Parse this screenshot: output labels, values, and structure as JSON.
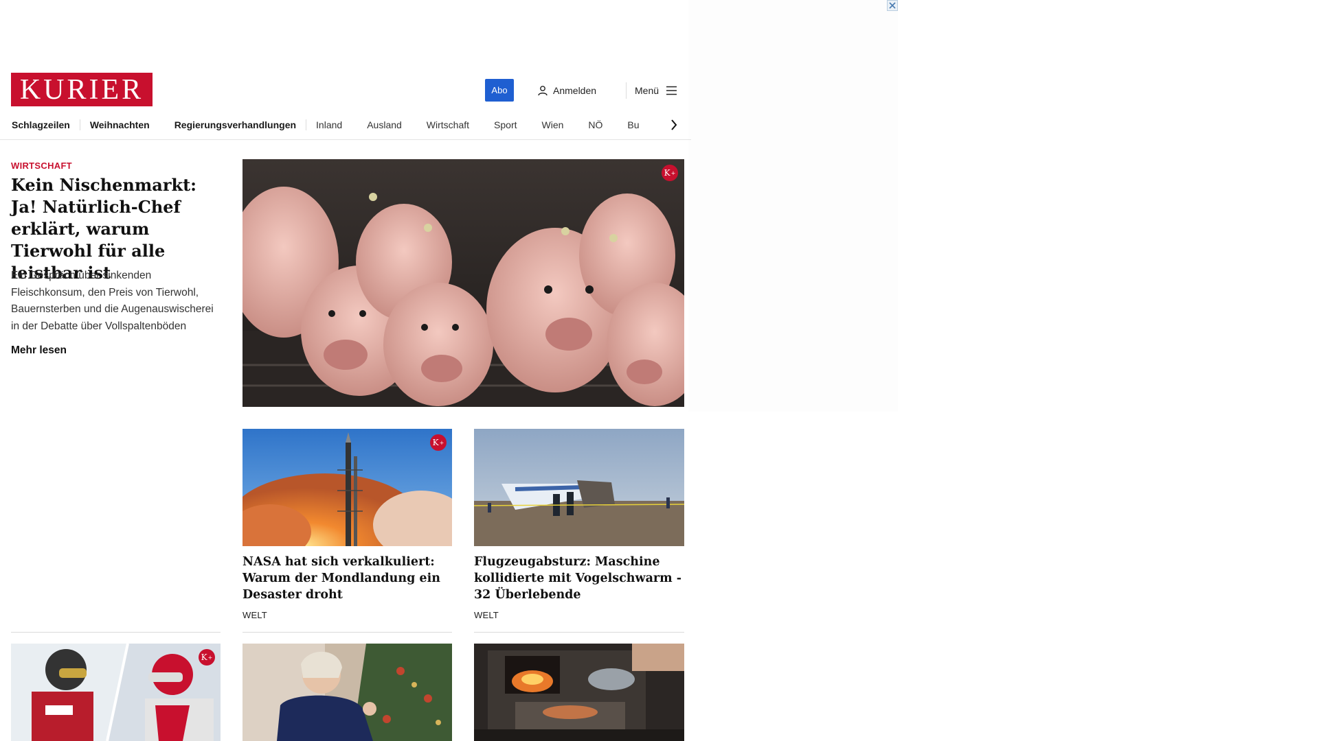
{
  "ad": {
    "close_icon": "close-icon"
  },
  "header": {
    "logo_text": "KURIER",
    "abo_label": "Abo",
    "login_label": "Anmelden",
    "menu_label": "Menü"
  },
  "nav": {
    "items": [
      {
        "label": "Schlagzeilen"
      },
      {
        "label": "Weihnachten"
      },
      {
        "label": "Regierungsverhandlungen"
      },
      {
        "label": "Inland"
      },
      {
        "label": "Ausland"
      },
      {
        "label": "Wirtschaft"
      },
      {
        "label": "Sport"
      },
      {
        "label": "Wien"
      },
      {
        "label": "NÖ"
      },
      {
        "label": "Bu"
      }
    ]
  },
  "lead": {
    "kicker": "WIRTSCHAFT",
    "title": "Kein Nischenmarkt: Ja! Natürlich-Chef erklärt, warum Tierwohl für alle leistbar ist",
    "teaser": "Ein Gespräch über sinkenden Fleischkonsum, den Preis von Tierwohl, Bauernsterben und die Augenauswischerei in der Debatte über Vollspaltenböden",
    "more_label": "Mehr lesen",
    "badge": "K"
  },
  "cards": [
    {
      "title": "NASA hat sich verkalkuliert: Warum der Mondlandung ein De­saster droht",
      "tag": "WELT",
      "badge": "K"
    },
    {
      "title": "Flugzeugabsturz: Maschine kolli­dierte mit Vogelschwarm - 32 Überlebende",
      "tag": "WELT"
    }
  ],
  "bottom_badge": "K",
  "colors": {
    "brand": "#c8102e",
    "abo": "#1f5fd1"
  }
}
